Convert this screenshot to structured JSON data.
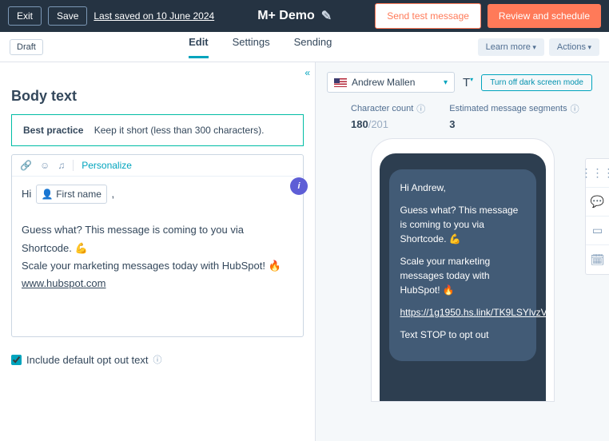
{
  "topbar": {
    "exit": "Exit",
    "save": "Save",
    "last_saved": "Last saved on 10 June 2024",
    "title": "M+ Demo",
    "send_test": "Send test message",
    "review": "Review and schedule"
  },
  "subbar": {
    "draft": "Draft",
    "tabs": {
      "edit": "Edit",
      "settings": "Settings",
      "sending": "Sending"
    },
    "learn_more": "Learn more",
    "actions": "Actions"
  },
  "left": {
    "heading": "Body text",
    "best_practice_label": "Best practice",
    "best_practice_text": "Keep it short (less than 300 characters).",
    "personalize": "Personalize",
    "greeting_prefix": "Hi",
    "token_label": "First name",
    "comma": ",",
    "line1": "Guess what? This message is coming to you via Shortcode. 💪",
    "line2": "Scale your marketing messages today with HubSpot! 🔥",
    "link": "www.hubspot.com",
    "optout_label": "Include default opt out text"
  },
  "right": {
    "contact_name": "Andrew Mallen",
    "dark_toggle": "Turn off dark screen mode",
    "char_label": "Character count",
    "char_current": "180",
    "char_max": "/201",
    "seg_label": "Estimated message segments",
    "seg_val": "3",
    "bubble": {
      "p1": "Hi Andrew,",
      "p2": "Guess what? This message is coming to you via Shortcode. 💪",
      "p3": "Scale your marketing messages today with HubSpot! 🔥",
      "link": "https://1g1950.hs.link/TK9LSYlvzV",
      "p4": "Text STOP to opt out"
    }
  },
  "icons": {
    "pencil": "✎",
    "collapse": "«",
    "link": "🔗",
    "smile": "☺",
    "headset": "♫",
    "person": "👤",
    "info": "i",
    "help": "ⓘ",
    "text_t": "T",
    "text_sub": "▾",
    "chev_down": "▾",
    "grid": "⋮⋮⋮",
    "chat": "💬",
    "window": "▭",
    "calendar": "🗓"
  }
}
